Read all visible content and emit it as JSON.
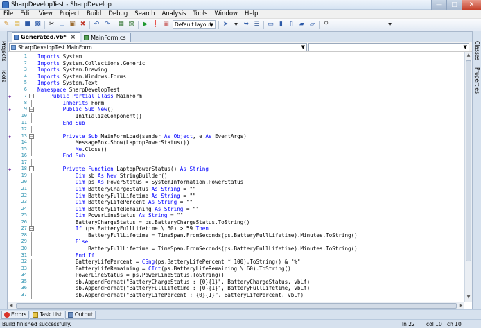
{
  "window": {
    "title": "SharpDevelopTest - SharpDevelop"
  },
  "menu": [
    "File",
    "Edit",
    "View",
    "Project",
    "Build",
    "Debug",
    "Search",
    "Analysis",
    "Tools",
    "Window",
    "Help"
  ],
  "toolbar": {
    "layout_label": "Default layout"
  },
  "left_pads": [
    "Projects",
    "Tools"
  ],
  "right_pads": [
    "Classes",
    "Properties"
  ],
  "tabs": [
    {
      "label": "Generated.vb*",
      "active": true
    },
    {
      "label": "MainForm.cs",
      "active": false
    }
  ],
  "navbar": {
    "class_combo": "SharpDevelopTest.MainForm",
    "member_combo": ""
  },
  "code": [
    {
      "n": "1",
      "t": [
        [
          "k",
          "Imports"
        ],
        [
          "p",
          " System"
        ]
      ]
    },
    {
      "n": "2",
      "t": [
        [
          "k",
          "Imports"
        ],
        [
          "p",
          " System.Collections.Generic"
        ]
      ]
    },
    {
      "n": "3",
      "t": [
        [
          "k",
          "Imports"
        ],
        [
          "p",
          " System.Drawing"
        ]
      ]
    },
    {
      "n": "4",
      "t": [
        [
          "k",
          "Imports"
        ],
        [
          "p",
          " System.Windows.Forms"
        ]
      ]
    },
    {
      "n": "5",
      "t": [
        [
          "k",
          "Imports"
        ],
        [
          "p",
          " System.Text"
        ]
      ]
    },
    {
      "n": "6",
      "t": [
        [
          "k",
          "Namespace"
        ],
        [
          "p",
          " SharpDevelopTest"
        ]
      ]
    },
    {
      "n": "7",
      "t": [
        [
          "p",
          "    "
        ],
        [
          "k",
          "Public Partial Class"
        ],
        [
          "p",
          " MainForm"
        ]
      ]
    },
    {
      "n": "8",
      "t": [
        [
          "p",
          "        "
        ],
        [
          "k",
          "Inherits"
        ],
        [
          "p",
          " Form"
        ]
      ]
    },
    {
      "n": "9",
      "t": [
        [
          "p",
          "        "
        ],
        [
          "k",
          "Public Sub New"
        ],
        [
          "p",
          "()"
        ]
      ]
    },
    {
      "n": "10",
      "t": [
        [
          "p",
          "            InitializeComponent()"
        ]
      ]
    },
    {
      "n": "11",
      "t": [
        [
          "p",
          "        "
        ],
        [
          "k",
          "End Sub"
        ]
      ]
    },
    {
      "n": "12",
      "t": [
        [
          "p",
          ""
        ]
      ]
    },
    {
      "n": "13",
      "t": [
        [
          "p",
          "        "
        ],
        [
          "k",
          "Private Sub"
        ],
        [
          "p",
          " MainFormLoad(sender "
        ],
        [
          "k",
          "As Object"
        ],
        [
          "p",
          ", e "
        ],
        [
          "k",
          "As"
        ],
        [
          "p",
          " EventArgs)"
        ]
      ]
    },
    {
      "n": "14",
      "t": [
        [
          "p",
          "            MessageBox.Show(LaptopPowerStatus())"
        ]
      ]
    },
    {
      "n": "15",
      "t": [
        [
          "p",
          "            "
        ],
        [
          "k",
          "Me"
        ],
        [
          "p",
          ".Close()"
        ]
      ]
    },
    {
      "n": "16",
      "t": [
        [
          "p",
          "        "
        ],
        [
          "k",
          "End Sub"
        ]
      ]
    },
    {
      "n": "17",
      "t": [
        [
          "p",
          ""
        ]
      ]
    },
    {
      "n": "18",
      "t": [
        [
          "p",
          "        "
        ],
        [
          "k",
          "Private Function"
        ],
        [
          "p",
          " LaptopPowerStatus() "
        ],
        [
          "k",
          "As String"
        ]
      ]
    },
    {
      "n": "19",
      "t": [
        [
          "p",
          "            "
        ],
        [
          "k",
          "Dim"
        ],
        [
          "p",
          " sb "
        ],
        [
          "k",
          "As New"
        ],
        [
          "p",
          " StringBuilder()"
        ]
      ]
    },
    {
      "n": "20",
      "t": [
        [
          "p",
          "            "
        ],
        [
          "k",
          "Dim"
        ],
        [
          "p",
          " ps "
        ],
        [
          "k",
          "As"
        ],
        [
          "p",
          " PowerStatus = SystemInformation.PowerStatus"
        ]
      ]
    },
    {
      "n": "21",
      "t": [
        [
          "p",
          "            "
        ],
        [
          "k",
          "Dim"
        ],
        [
          "p",
          " BatteryChargeStatus "
        ],
        [
          "k",
          "As String"
        ],
        [
          "p",
          " = \"\""
        ]
      ]
    },
    {
      "n": "22",
      "t": [
        [
          "p",
          "            "
        ],
        [
          "k",
          "Dim"
        ],
        [
          "p",
          " BatteryFullLifetime "
        ],
        [
          "k",
          "As String"
        ],
        [
          "p",
          " = \"\""
        ]
      ]
    },
    {
      "n": "23",
      "t": [
        [
          "p",
          "            "
        ],
        [
          "k",
          "Dim"
        ],
        [
          "p",
          " BatteryLifePercent "
        ],
        [
          "k",
          "As String"
        ],
        [
          "p",
          " = \"\""
        ]
      ]
    },
    {
      "n": "24",
      "t": [
        [
          "p",
          "            "
        ],
        [
          "k",
          "Dim"
        ],
        [
          "p",
          " BatteryLifeRemaining "
        ],
        [
          "k",
          "As String"
        ],
        [
          "p",
          " = \"\""
        ]
      ]
    },
    {
      "n": "25",
      "t": [
        [
          "p",
          "            "
        ],
        [
          "k",
          "Dim"
        ],
        [
          "p",
          " PowerLineStatus "
        ],
        [
          "k",
          "As String"
        ],
        [
          "p",
          " = \"\""
        ]
      ]
    },
    {
      "n": "26",
      "t": [
        [
          "p",
          "            BatteryChargeStatus = ps.BatteryChargeStatus.ToString()"
        ]
      ]
    },
    {
      "n": "27",
      "t": [
        [
          "p",
          "            "
        ],
        [
          "k",
          "If"
        ],
        [
          "p",
          " (ps.BatteryFullLifetime \\ 60) > 59 "
        ],
        [
          "k",
          "Then"
        ]
      ]
    },
    {
      "n": "28",
      "t": [
        [
          "p",
          "                BatteryFullLifetime = TimeSpan.FromSeconds(ps.BatteryFullLifetime).Minutes.ToString()"
        ]
      ]
    },
    {
      "n": "29",
      "t": [
        [
          "p",
          "            "
        ],
        [
          "k",
          "Else"
        ]
      ]
    },
    {
      "n": "30",
      "t": [
        [
          "p",
          "                BatteryFullLifetime = TimeSpan.FromSeconds(ps.BatteryFullLifetime).Minutes.ToString()"
        ]
      ]
    },
    {
      "n": "31",
      "t": [
        [
          "p",
          "            "
        ],
        [
          "k",
          "End If"
        ]
      ]
    },
    {
      "n": "32",
      "t": [
        [
          "p",
          "            BatteryLifePercent = "
        ],
        [
          "k",
          "CSng"
        ],
        [
          "p",
          "(ps.BatteryLifePercent * 100).ToString() & \"%\""
        ]
      ]
    },
    {
      "n": "33",
      "t": [
        [
          "p",
          "            BatteryLifeRemaining = "
        ],
        [
          "k",
          "CInt"
        ],
        [
          "p",
          "(ps.BatteryLifeRemaining \\ 60).ToString()"
        ]
      ]
    },
    {
      "n": "34",
      "t": [
        [
          "p",
          "            PowerLineStatus = ps.PowerLineStatus.ToString()"
        ]
      ]
    },
    {
      "n": "35",
      "t": [
        [
          "p",
          "            sb.AppendFormat(\"BatteryChargeStatus : {0}{1}\", BatteryChargeStatus, vbLf)"
        ]
      ]
    },
    {
      "n": "36",
      "t": [
        [
          "p",
          "            sb.AppendFormat(\"BatteryFullLifetime : {0}{1}\", BatteryFullLifetime, vbLf)"
        ]
      ]
    },
    {
      "n": "37",
      "t": [
        [
          "p",
          "            sb.AppendFormat(\"BatteryLifePercent : {0}{1}\", BatteryLifePercent, vbLf)"
        ]
      ]
    }
  ],
  "bottom_tabs": [
    "Errors",
    "Task List",
    "Output"
  ],
  "status": {
    "message": "Build finished successfully.",
    "line": "ln 22",
    "col": "col 10",
    "ch": "ch 10"
  }
}
